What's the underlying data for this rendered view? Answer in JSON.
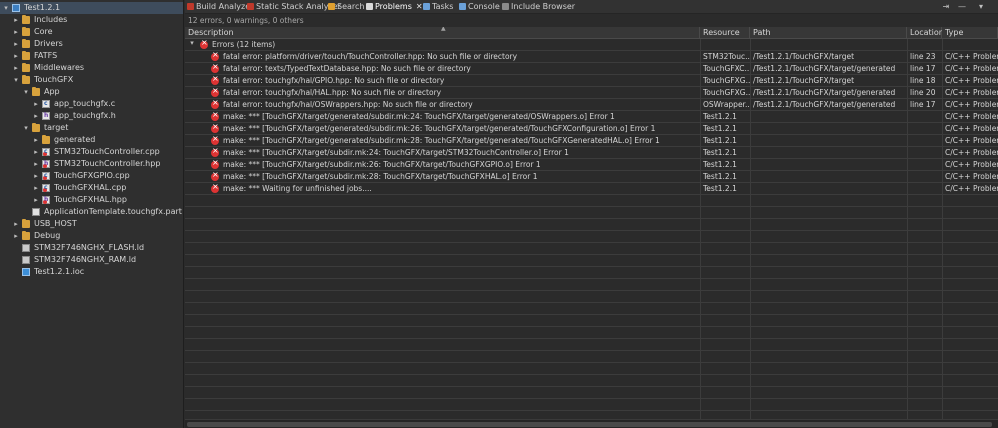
{
  "explorer": {
    "items": [
      {
        "label": "Test1.2.1",
        "twisty": "▾",
        "icon": "project"
      },
      {
        "label": "Includes",
        "twisty": "▸",
        "icon": "folder"
      },
      {
        "label": "Core",
        "twisty": "▸",
        "icon": "folder"
      },
      {
        "label": "Drivers",
        "twisty": "▸",
        "icon": "folder"
      },
      {
        "label": "FATFS",
        "twisty": "▸",
        "icon": "folder"
      },
      {
        "label": "Middlewares",
        "twisty": "▸",
        "icon": "folder"
      },
      {
        "label": "TouchGFX",
        "twisty": "▾",
        "icon": "folder"
      },
      {
        "label": "App",
        "twisty": "▾",
        "icon": "folder"
      },
      {
        "label": "app_touchgfx.c",
        "twisty": "▸",
        "icon": "cfile"
      },
      {
        "label": "app_touchgfx.h",
        "twisty": "▸",
        "icon": "hfile"
      },
      {
        "label": "target",
        "twisty": "▾",
        "icon": "folder"
      },
      {
        "label": "generated",
        "twisty": "▸",
        "icon": "folder"
      },
      {
        "label": "STM32TouchController.cpp",
        "twisty": "▸",
        "icon": "cfile"
      },
      {
        "label": "STM32TouchController.hpp",
        "twisty": "▸",
        "icon": "hfile"
      },
      {
        "label": "TouchGFXGPIO.cpp",
        "twisty": "▸",
        "icon": "cfile"
      },
      {
        "label": "TouchGFXHAL.cpp",
        "twisty": "▸",
        "icon": "cfile"
      },
      {
        "label": "TouchGFXHAL.hpp",
        "twisty": "▸",
        "icon": "hfile"
      },
      {
        "label": "ApplicationTemplate.touchgfx.part",
        "twisty": "",
        "icon": "partfile"
      },
      {
        "label": "USB_HOST",
        "twisty": "▸",
        "icon": "folder"
      },
      {
        "label": "Debug",
        "twisty": "▸",
        "icon": "folder"
      },
      {
        "label": "STM32F746NGHX_FLASH.ld",
        "twisty": "",
        "icon": "ldfile"
      },
      {
        "label": "STM32F746NGHX_RAM.ld",
        "twisty": "",
        "icon": "ldfile"
      },
      {
        "label": "Test1.2.1.ioc",
        "twisty": "",
        "icon": "iocfile"
      }
    ]
  },
  "tabs": [
    {
      "label": "Build Analyzer",
      "icon_color": "#c0392b"
    },
    {
      "label": "Static Stack Analyzer",
      "icon_color": "#c0392b"
    },
    {
      "label": "Search",
      "icon_color": "#e0a030"
    },
    {
      "label": "Problems",
      "icon_color": "#d9d9d9",
      "close": "✕"
    },
    {
      "label": "Tasks",
      "icon_color": "#6aa0d8"
    },
    {
      "label": "Console",
      "icon_color": "#6aa0d8"
    },
    {
      "label": "Include Browser",
      "icon_color": "#8a8a8a"
    }
  ],
  "summary": "12 errors, 0 warnings, 0 others",
  "columns": {
    "description": "Description",
    "resource": "Resource",
    "path": "Path",
    "location": "Location",
    "type": "Type"
  },
  "group": {
    "twisty": "▾",
    "label": "Errors (12 items)"
  },
  "rows": [
    {
      "description": "fatal error: platform/driver/touch/TouchController.hpp: No such file or directory",
      "resource": "STM32Touc...",
      "path": "/Test1.2.1/TouchGFX/target",
      "location": "line 23",
      "type": "C/C++ Problem"
    },
    {
      "description": "fatal error: texts/TypedTextDatabase.hpp: No such file or directory",
      "resource": "TouchGFXC...",
      "path": "/Test1.2.1/TouchGFX/target/generated",
      "location": "line 17",
      "type": "C/C++ Problem"
    },
    {
      "description": "fatal error: touchgfx/hal/GPIO.hpp: No such file or directory",
      "resource": "TouchGFXG...",
      "path": "/Test1.2.1/TouchGFX/target",
      "location": "line 18",
      "type": "C/C++ Problem"
    },
    {
      "description": "fatal error: touchgfx/hal/HAL.hpp: No such file or directory",
      "resource": "TouchGFXG...",
      "path": "/Test1.2.1/TouchGFX/target/generated",
      "location": "line 20",
      "type": "C/C++ Problem"
    },
    {
      "description": "fatal error: touchgfx/hal/OSWrappers.hpp: No such file or directory",
      "resource": "OSWrapper...",
      "path": "/Test1.2.1/TouchGFX/target/generated",
      "location": "line 17",
      "type": "C/C++ Problem"
    },
    {
      "description": "make: *** [TouchGFX/target/generated/subdir.mk:24: TouchGFX/target/generated/OSWrappers.o] Error 1",
      "resource": "Test1.2.1",
      "path": "",
      "location": "",
      "type": "C/C++ Problem"
    },
    {
      "description": "make: *** [TouchGFX/target/generated/subdir.mk:26: TouchGFX/target/generated/TouchGFXConfiguration.o] Error 1",
      "resource": "Test1.2.1",
      "path": "",
      "location": "",
      "type": "C/C++ Problem"
    },
    {
      "description": "make: *** [TouchGFX/target/generated/subdir.mk:28: TouchGFX/target/generated/TouchGFXGeneratedHAL.o] Error 1",
      "resource": "Test1.2.1",
      "path": "",
      "location": "",
      "type": "C/C++ Problem"
    },
    {
      "description": "make: *** [TouchGFX/target/subdir.mk:24: TouchGFX/target/STM32TouchController.o] Error 1",
      "resource": "Test1.2.1",
      "path": "",
      "location": "",
      "type": "C/C++ Problem"
    },
    {
      "description": "make: *** [TouchGFX/target/subdir.mk:26: TouchGFX/target/TouchGFXGPIO.o] Error 1",
      "resource": "Test1.2.1",
      "path": "",
      "location": "",
      "type": "C/C++ Problem"
    },
    {
      "description": "make: *** [TouchGFX/target/subdir.mk:28: TouchGFX/target/TouchGFXHAL.o] Error 1",
      "resource": "Test1.2.1",
      "path": "",
      "location": "",
      "type": "C/C++ Problem"
    },
    {
      "description": "make: *** Waiting for unfinished jobs....",
      "resource": "Test1.2.1",
      "path": "",
      "location": "",
      "type": "C/C++ Problem"
    }
  ]
}
